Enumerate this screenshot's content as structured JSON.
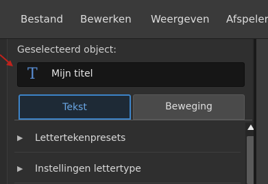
{
  "menu": {
    "items": [
      "Bestand",
      "Bewerken",
      "Weergeven",
      "Afspeler"
    ]
  },
  "panel": {
    "selected_label": "Geselecteerd object:",
    "title_icon": "T",
    "title_value": "Mijn titel",
    "tabs": [
      {
        "label": "Tekst",
        "active": true
      },
      {
        "label": "Beweging",
        "active": false
      }
    ],
    "accordion": [
      {
        "label": "Lettertekenpresets"
      },
      {
        "label": "Instellingen lettertype"
      }
    ]
  },
  "colors": {
    "accent": "#3d84c9",
    "callout": "#c0221c"
  },
  "icons": {
    "text_type": "text-type-icon",
    "expand": "triangle-right-icon",
    "scroll_up": "triangle-up-icon"
  }
}
